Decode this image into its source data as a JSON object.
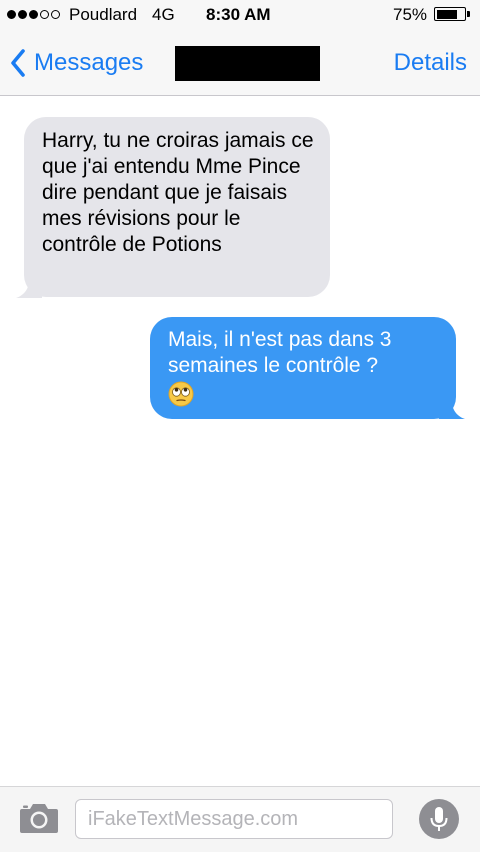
{
  "status_bar": {
    "carrier": "Poudlard",
    "network": "4G",
    "time": "8:30 AM",
    "battery_percent": "75%",
    "battery_level": 0.75,
    "signal_bars_filled": 3,
    "signal_bars_total": 5
  },
  "nav": {
    "back_label": "Messages",
    "contact_name": "",
    "details_label": "Details"
  },
  "messages": [
    {
      "direction": "received",
      "text": "Harry, tu ne croiras jamais ce que j'ai entendu Mme Pince dire pendant que je faisais mes révisions pour le contrôle de Potions"
    },
    {
      "direction": "sent",
      "text": "Mais, il n'est pas dans 3 semaines le contrôle ?",
      "emoji": "face-with-rolling-eyes-icon"
    }
  ],
  "composer": {
    "placeholder": "iFakeTextMessage.com",
    "value": ""
  },
  "colors": {
    "accent": "#1a7cf2",
    "sent_bubble": "#3a98f4",
    "received_bubble": "#e5e5ea"
  },
  "icons": {
    "back": "chevron-left-icon",
    "camera": "camera-icon",
    "mic": "microphone-icon"
  }
}
